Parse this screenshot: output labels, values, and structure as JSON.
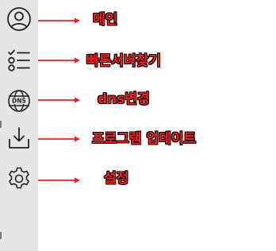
{
  "sidebar": {
    "items": [
      {
        "icon": "user-icon",
        "label": "메인"
      },
      {
        "icon": "list-icon",
        "label": "빠른서버찾기"
      },
      {
        "icon": "dns-globe-icon",
        "label": "dns변경",
        "icon_text": "DNS"
      },
      {
        "icon": "download-icon",
        "label": "프로그램 업데이트"
      },
      {
        "icon": "gear-icon",
        "label": "설정"
      }
    ]
  },
  "colors": {
    "annotation": "#ff1a1a",
    "sidebar_bg": "#e6e6e6",
    "icon_stroke": "#222222"
  }
}
